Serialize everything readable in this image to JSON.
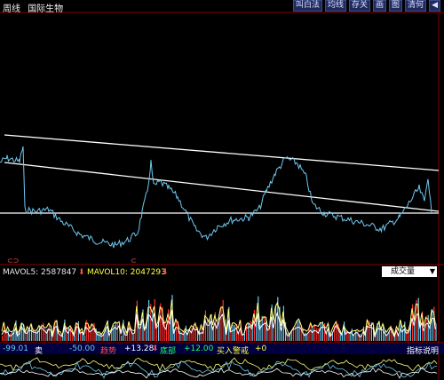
{
  "topbar": {
    "left_labels": [
      "周线",
      "国际生物"
    ],
    "buttons": [
      "叫白法",
      "均线",
      "存关",
      "画",
      "图",
      "清何",
      "◀"
    ]
  },
  "indicators": {
    "mavol5": "MAVOL5: 2587847",
    "mavol10": "MAVOL10: 2047293",
    "select_value": "成交量"
  },
  "bottom": {
    "v1": "-99.01",
    "label_a": "卖",
    "v2": "-50.00",
    "label_b": "趋势",
    "v3": "+13.28",
    "label_c": "底部",
    "v4": "+12.00",
    "label_d": "买入警戒",
    "v5": "+0",
    "help": "指标说明"
  },
  "colors": {
    "price_line": "#6fc8f0",
    "trend_line": "#ffffff",
    "vol_up": "#ff3030",
    "vol_down": "#6fc8f0",
    "vol_ma1": "#ffff80",
    "vol_ma2": "#ffffff",
    "accent_green": "#20ff60",
    "accent_yellow": "#ffff40",
    "accent_red": "#ff5050"
  },
  "markers": [
    "⊂⊃",
    "⊂"
  ]
}
